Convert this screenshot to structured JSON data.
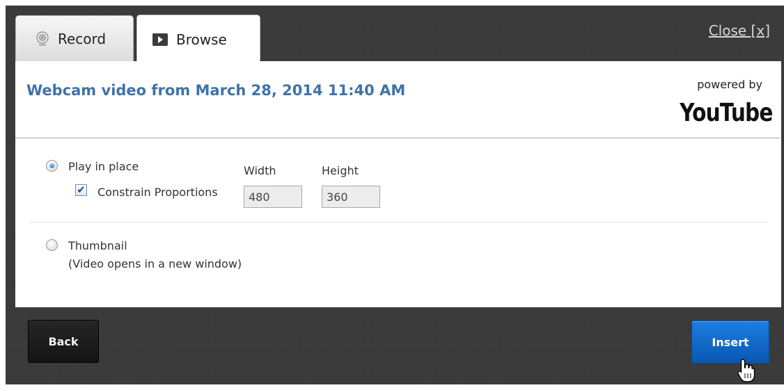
{
  "tabs": [
    {
      "label": "Record",
      "icon": "webcam-icon",
      "active": false
    },
    {
      "label": "Browse",
      "icon": "play-icon",
      "active": true
    }
  ],
  "close_label": "Close [x]",
  "video_title": "Webcam video from March 28, 2014 11:40 AM",
  "powered_by": {
    "text": "powered by",
    "brand": "YouTube"
  },
  "options": {
    "play_in_place": {
      "label": "Play in place",
      "selected": true
    },
    "constrain": {
      "label": "Constrain Proportions",
      "checked": true
    },
    "width": {
      "label": "Width",
      "value": "480"
    },
    "height": {
      "label": "Height",
      "value": "360"
    },
    "thumbnail": {
      "label": "Thumbnail",
      "note": "(Video opens in a new window)",
      "selected": false
    }
  },
  "buttons": {
    "back": "Back",
    "insert": "Insert"
  },
  "colors": {
    "title": "#3f73aa",
    "insert": "#0a66c8",
    "backdrop": "#3a3a3a"
  }
}
